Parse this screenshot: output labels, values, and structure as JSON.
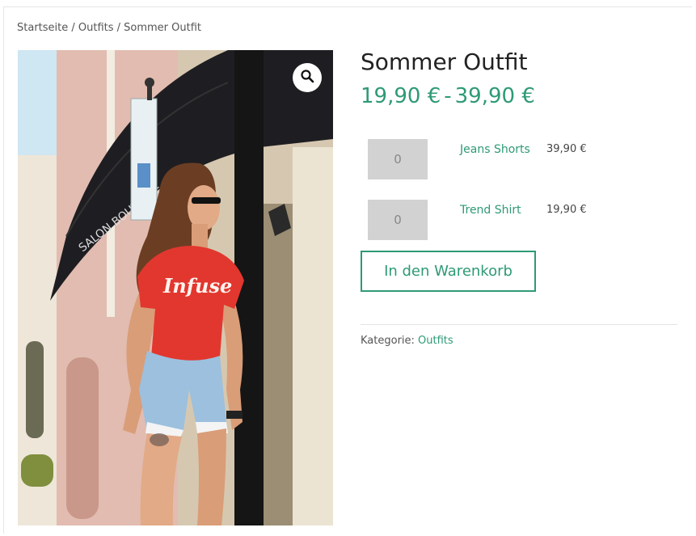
{
  "breadcrumb": {
    "text": "Startseite / Outfits / Sommer Outfit"
  },
  "product": {
    "title": "Sommer Outfit",
    "price_min": "19,90 €",
    "price_sep": "-",
    "price_max": "39,90 €",
    "shirt_print": "Infuse",
    "shop_sign": "SALON BOUTIQUE"
  },
  "grouped_items": [
    {
      "qty": "0",
      "name": "Jeans Shorts",
      "price": "39,90 €"
    },
    {
      "qty": "0",
      "name": "Trend Shirt",
      "price": "19,90 €"
    }
  ],
  "cart_button": {
    "label": "In den Warenkorb"
  },
  "meta": {
    "category_label": "Kategorie:",
    "category_value": "Outfits"
  },
  "icons": {
    "zoom": "magnifier-icon"
  },
  "colors": {
    "accent": "#2e9a75",
    "input_bg": "#d2d2d2",
    "shirt": "#e2372e",
    "awning": "#1e1e22"
  }
}
